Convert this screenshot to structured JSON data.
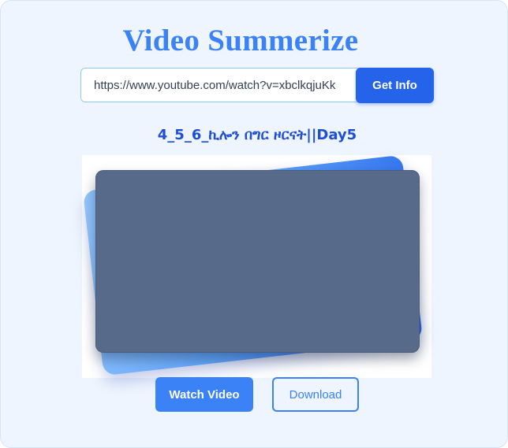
{
  "app": {
    "title": "Video Summerize"
  },
  "search": {
    "url_value": "https://www.youtube.com/watch?v=xbclkqjuKk",
    "submit_label": "Get Info"
  },
  "video": {
    "title": "4_5_6_ኪሎን በግር ዞርናት||Day5"
  },
  "actions": {
    "watch_label": "Watch Video",
    "download_label": "Download"
  },
  "colors": {
    "accent": "#3b82f6",
    "accent_dark": "#2563eb",
    "title_text": "#1d4ed8",
    "background": "#eef5fe",
    "thumbnail": "#576a8a"
  }
}
